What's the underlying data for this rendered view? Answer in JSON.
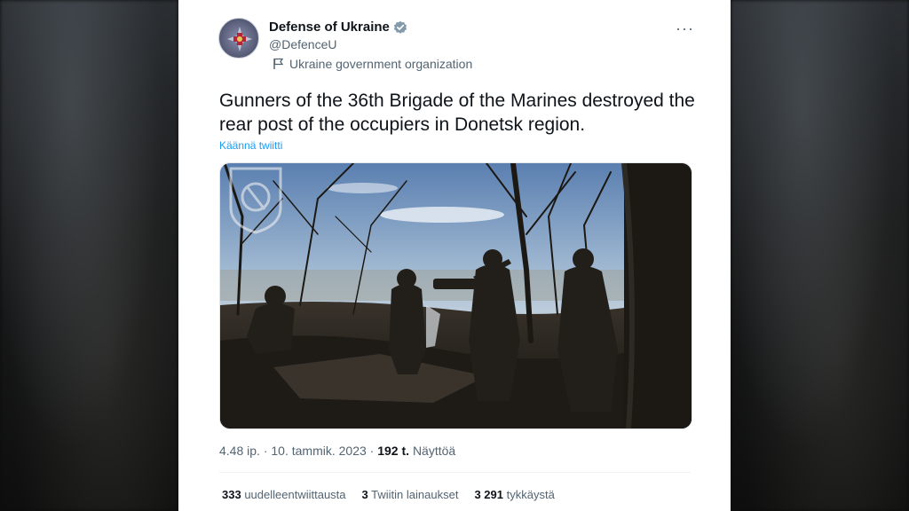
{
  "tweet": {
    "author_name": "Defense of Ukraine",
    "handle": "@DefenceU",
    "gov_label": "Ukraine government organization",
    "more_label": "···",
    "text": "Gunners of the 36th Brigade of the Marines destroyed the rear post of the occupiers in Donetsk region.",
    "translate_link": "Käännä twiitti",
    "time": "4.48 ip.",
    "date": "10. tammik. 2023",
    "dot": "·",
    "views_count": "192 t.",
    "views_label": "Näyttöä"
  },
  "stats": {
    "retweets_count": "333",
    "retweets_label": "uudelleentwiittausta",
    "quotes_count": "3",
    "quotes_label": "Twiitin lainaukset",
    "likes_count": "3 291",
    "likes_label": "tykkäystä"
  },
  "colors": {
    "link": "#1d9bf0",
    "verified_badge": "#829aab",
    "text_primary": "#0f1419",
    "text_secondary": "#536471"
  },
  "icons": [
    "verified-badge-icon",
    "flag-icon",
    "more-options-icon",
    "brigade-emblem-icon"
  ]
}
